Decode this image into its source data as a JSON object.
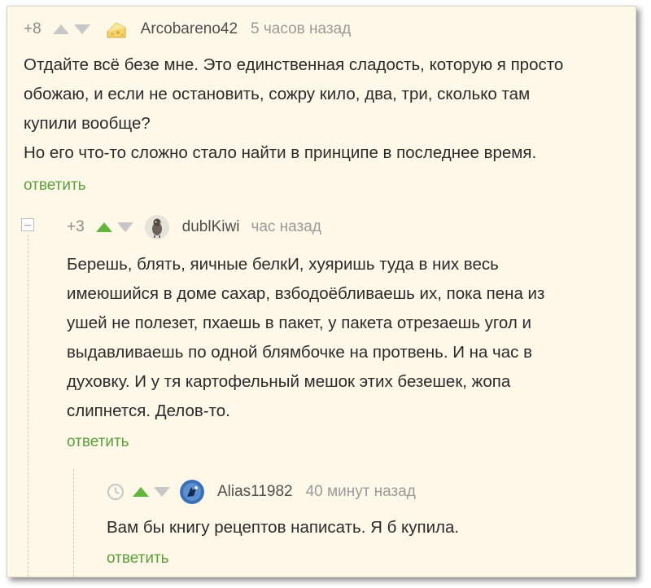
{
  "comments": [
    {
      "rating": "+8",
      "author": "Arcobareno42",
      "time": "5 часов назад",
      "lines": [
        "Отдайте всё безе мне. Это единственная сладость, которую я просто",
        "обожаю, и если не остановить, сожру кило, два, три, сколько там",
        "купили вообще?",
        "Но его что-то сложно стало найти в принципе в последнее время."
      ],
      "reply_label": "ответить",
      "avatar_icon": "cheese-avatar-icon"
    },
    {
      "rating": "+3",
      "author": "dublKiwi",
      "time": "час назад",
      "lines": [
        "Берешь, блять, яичные белкИ, хуяришь туда в них весь",
        "имеюшийся в доме сахар, взбодоёбливаешь их, пока пена из",
        "ушей не полезет, пхаешь в пакет, у пакета отрезаешь угол и",
        "выдавливаешь по одной блямбочке на протвень. И на час в",
        "духовку. И у тя картофельный мешок этих безешек, жопа",
        "слипнется. Делов-то."
      ],
      "reply_label": "ответить",
      "avatar_icon": "bird-avatar-icon"
    },
    {
      "author": "Alias11982",
      "time": "40 минут назад",
      "lines": [
        "Вам бы книгу рецептов написать. Я б купила."
      ],
      "reply_label": "ответить",
      "avatar_icon": "blue-figure-avatar-icon"
    }
  ],
  "colors": {
    "background": "#fdf8e8",
    "reply_link": "#5e9e3c",
    "upvote_active": "#64b53d",
    "vote_inactive": "#c7c7c7"
  }
}
